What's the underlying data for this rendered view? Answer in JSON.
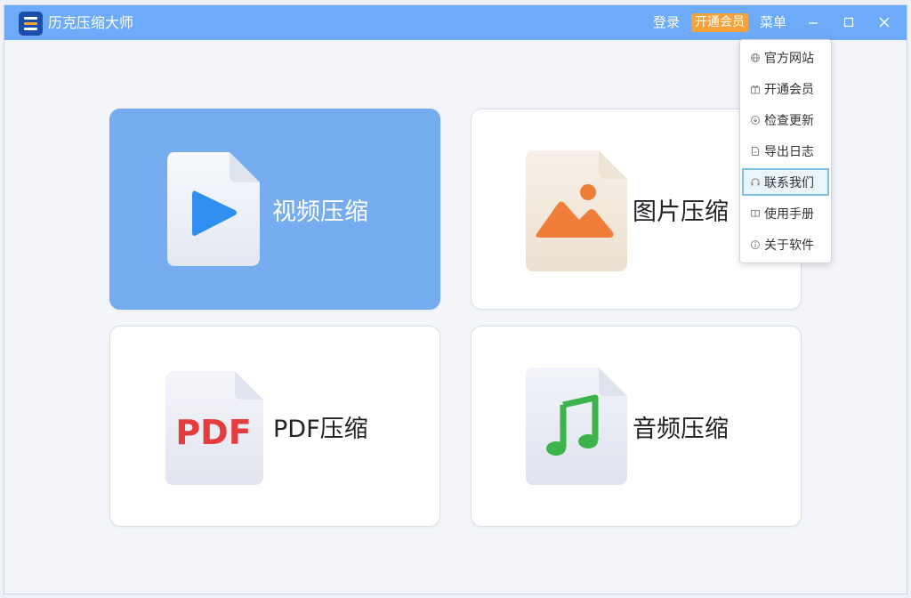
{
  "window": {
    "title": "历克压缩大师",
    "login_label": "登录",
    "vip_label": "开通会员",
    "menu_label": "菜单"
  },
  "colors": {
    "titlebar": "#6daaf8",
    "active_card": "#76acf0",
    "vip_badge": "#f6a23a",
    "menu_highlight": "#eaf4fb"
  },
  "cards": [
    {
      "label": "视频压缩",
      "icon": "video-file-icon",
      "active": true
    },
    {
      "label": "图片压缩",
      "icon": "image-file-icon",
      "active": false
    },
    {
      "label": "PDF压缩",
      "icon": "pdf-file-icon",
      "active": false
    },
    {
      "label": "音频压缩",
      "icon": "audio-file-icon",
      "active": false
    }
  ],
  "pdf_icon_text": "PDF",
  "dropdown_menu": {
    "items": [
      {
        "label": "官方网站",
        "icon": "globe-icon"
      },
      {
        "label": "开通会员",
        "icon": "gift-icon"
      },
      {
        "label": "检查更新",
        "icon": "update-icon"
      },
      {
        "label": "导出日志",
        "icon": "export-icon"
      },
      {
        "label": "联系我们",
        "icon": "headset-icon",
        "highlighted": true
      },
      {
        "label": "使用手册",
        "icon": "book-icon"
      },
      {
        "label": "关于软件",
        "icon": "info-icon"
      }
    ]
  }
}
